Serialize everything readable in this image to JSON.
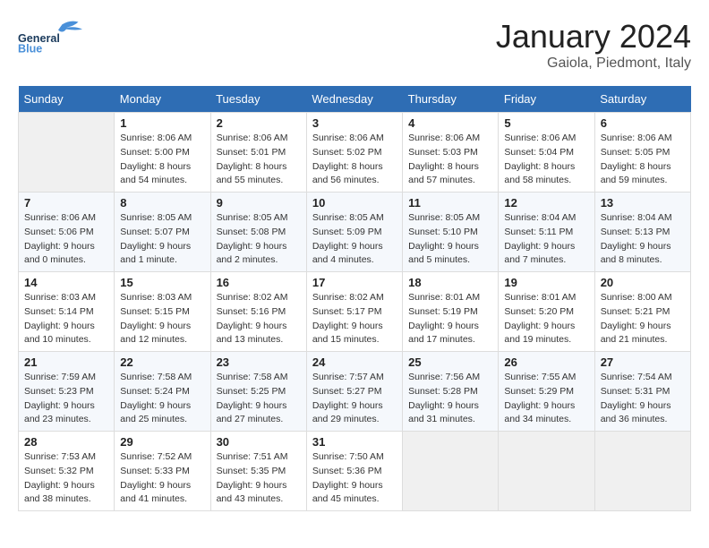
{
  "header": {
    "logo_general": "General",
    "logo_blue": "Blue",
    "title": "January 2024",
    "subtitle": "Gaiola, Piedmont, Italy"
  },
  "days_of_week": [
    "Sunday",
    "Monday",
    "Tuesday",
    "Wednesday",
    "Thursday",
    "Friday",
    "Saturday"
  ],
  "weeks": [
    [
      {
        "day": "",
        "info": ""
      },
      {
        "day": "1",
        "info": "Sunrise: 8:06 AM\nSunset: 5:00 PM\nDaylight: 8 hours\nand 54 minutes."
      },
      {
        "day": "2",
        "info": "Sunrise: 8:06 AM\nSunset: 5:01 PM\nDaylight: 8 hours\nand 55 minutes."
      },
      {
        "day": "3",
        "info": "Sunrise: 8:06 AM\nSunset: 5:02 PM\nDaylight: 8 hours\nand 56 minutes."
      },
      {
        "day": "4",
        "info": "Sunrise: 8:06 AM\nSunset: 5:03 PM\nDaylight: 8 hours\nand 57 minutes."
      },
      {
        "day": "5",
        "info": "Sunrise: 8:06 AM\nSunset: 5:04 PM\nDaylight: 8 hours\nand 58 minutes."
      },
      {
        "day": "6",
        "info": "Sunrise: 8:06 AM\nSunset: 5:05 PM\nDaylight: 8 hours\nand 59 minutes."
      }
    ],
    [
      {
        "day": "7",
        "info": "Sunrise: 8:06 AM\nSunset: 5:06 PM\nDaylight: 9 hours\nand 0 minutes."
      },
      {
        "day": "8",
        "info": "Sunrise: 8:05 AM\nSunset: 5:07 PM\nDaylight: 9 hours\nand 1 minute."
      },
      {
        "day": "9",
        "info": "Sunrise: 8:05 AM\nSunset: 5:08 PM\nDaylight: 9 hours\nand 2 minutes."
      },
      {
        "day": "10",
        "info": "Sunrise: 8:05 AM\nSunset: 5:09 PM\nDaylight: 9 hours\nand 4 minutes."
      },
      {
        "day": "11",
        "info": "Sunrise: 8:05 AM\nSunset: 5:10 PM\nDaylight: 9 hours\nand 5 minutes."
      },
      {
        "day": "12",
        "info": "Sunrise: 8:04 AM\nSunset: 5:11 PM\nDaylight: 9 hours\nand 7 minutes."
      },
      {
        "day": "13",
        "info": "Sunrise: 8:04 AM\nSunset: 5:13 PM\nDaylight: 9 hours\nand 8 minutes."
      }
    ],
    [
      {
        "day": "14",
        "info": "Sunrise: 8:03 AM\nSunset: 5:14 PM\nDaylight: 9 hours\nand 10 minutes."
      },
      {
        "day": "15",
        "info": "Sunrise: 8:03 AM\nSunset: 5:15 PM\nDaylight: 9 hours\nand 12 minutes."
      },
      {
        "day": "16",
        "info": "Sunrise: 8:02 AM\nSunset: 5:16 PM\nDaylight: 9 hours\nand 13 minutes."
      },
      {
        "day": "17",
        "info": "Sunrise: 8:02 AM\nSunset: 5:17 PM\nDaylight: 9 hours\nand 15 minutes."
      },
      {
        "day": "18",
        "info": "Sunrise: 8:01 AM\nSunset: 5:19 PM\nDaylight: 9 hours\nand 17 minutes."
      },
      {
        "day": "19",
        "info": "Sunrise: 8:01 AM\nSunset: 5:20 PM\nDaylight: 9 hours\nand 19 minutes."
      },
      {
        "day": "20",
        "info": "Sunrise: 8:00 AM\nSunset: 5:21 PM\nDaylight: 9 hours\nand 21 minutes."
      }
    ],
    [
      {
        "day": "21",
        "info": "Sunrise: 7:59 AM\nSunset: 5:23 PM\nDaylight: 9 hours\nand 23 minutes."
      },
      {
        "day": "22",
        "info": "Sunrise: 7:58 AM\nSunset: 5:24 PM\nDaylight: 9 hours\nand 25 minutes."
      },
      {
        "day": "23",
        "info": "Sunrise: 7:58 AM\nSunset: 5:25 PM\nDaylight: 9 hours\nand 27 minutes."
      },
      {
        "day": "24",
        "info": "Sunrise: 7:57 AM\nSunset: 5:27 PM\nDaylight: 9 hours\nand 29 minutes."
      },
      {
        "day": "25",
        "info": "Sunrise: 7:56 AM\nSunset: 5:28 PM\nDaylight: 9 hours\nand 31 minutes."
      },
      {
        "day": "26",
        "info": "Sunrise: 7:55 AM\nSunset: 5:29 PM\nDaylight: 9 hours\nand 34 minutes."
      },
      {
        "day": "27",
        "info": "Sunrise: 7:54 AM\nSunset: 5:31 PM\nDaylight: 9 hours\nand 36 minutes."
      }
    ],
    [
      {
        "day": "28",
        "info": "Sunrise: 7:53 AM\nSunset: 5:32 PM\nDaylight: 9 hours\nand 38 minutes."
      },
      {
        "day": "29",
        "info": "Sunrise: 7:52 AM\nSunset: 5:33 PM\nDaylight: 9 hours\nand 41 minutes."
      },
      {
        "day": "30",
        "info": "Sunrise: 7:51 AM\nSunset: 5:35 PM\nDaylight: 9 hours\nand 43 minutes."
      },
      {
        "day": "31",
        "info": "Sunrise: 7:50 AM\nSunset: 5:36 PM\nDaylight: 9 hours\nand 45 minutes."
      },
      {
        "day": "",
        "info": ""
      },
      {
        "day": "",
        "info": ""
      },
      {
        "day": "",
        "info": ""
      }
    ]
  ]
}
